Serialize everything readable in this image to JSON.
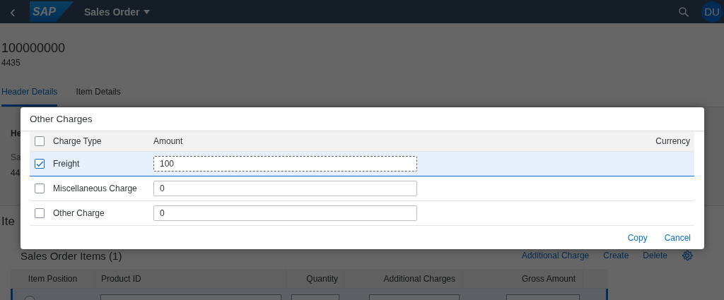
{
  "shell": {
    "back": "‹",
    "logo": "SAP",
    "title": "Sales Order",
    "avatar": "DU"
  },
  "object_header": {
    "title": "100000000",
    "subtitle": "4435"
  },
  "tabs": [
    {
      "label": "Header Details",
      "selected": true
    },
    {
      "label": "Item Details",
      "selected": false
    }
  ],
  "header_section": {
    "title": "He",
    "label": "Sa",
    "value": "44"
  },
  "items_section": {
    "title": "Ite",
    "row": {
      "selected": false
    },
    "table_title": "Sales Order Items (1)",
    "actions": [
      "Additional Charge",
      "Create",
      "Delete"
    ],
    "columns": [
      "Item Position",
      "Product ID",
      "Quantity",
      "Additional Charges",
      "Gross Amount"
    ]
  },
  "dialog": {
    "title": "Other Charges",
    "select_all": {
      "checked": false
    },
    "columns": [
      "Charge Type",
      "Amount",
      "Currency"
    ],
    "rows": [
      {
        "charge_type": "Freight",
        "amount": "100",
        "checked": true,
        "selected": true
      },
      {
        "charge_type": "Miscellaneous Charge",
        "amount": "0",
        "checked": false,
        "selected": false
      },
      {
        "charge_type": "Other Charge",
        "amount": "0",
        "checked": false,
        "selected": false
      }
    ],
    "buttons": [
      "Copy",
      "Cancel"
    ]
  }
}
